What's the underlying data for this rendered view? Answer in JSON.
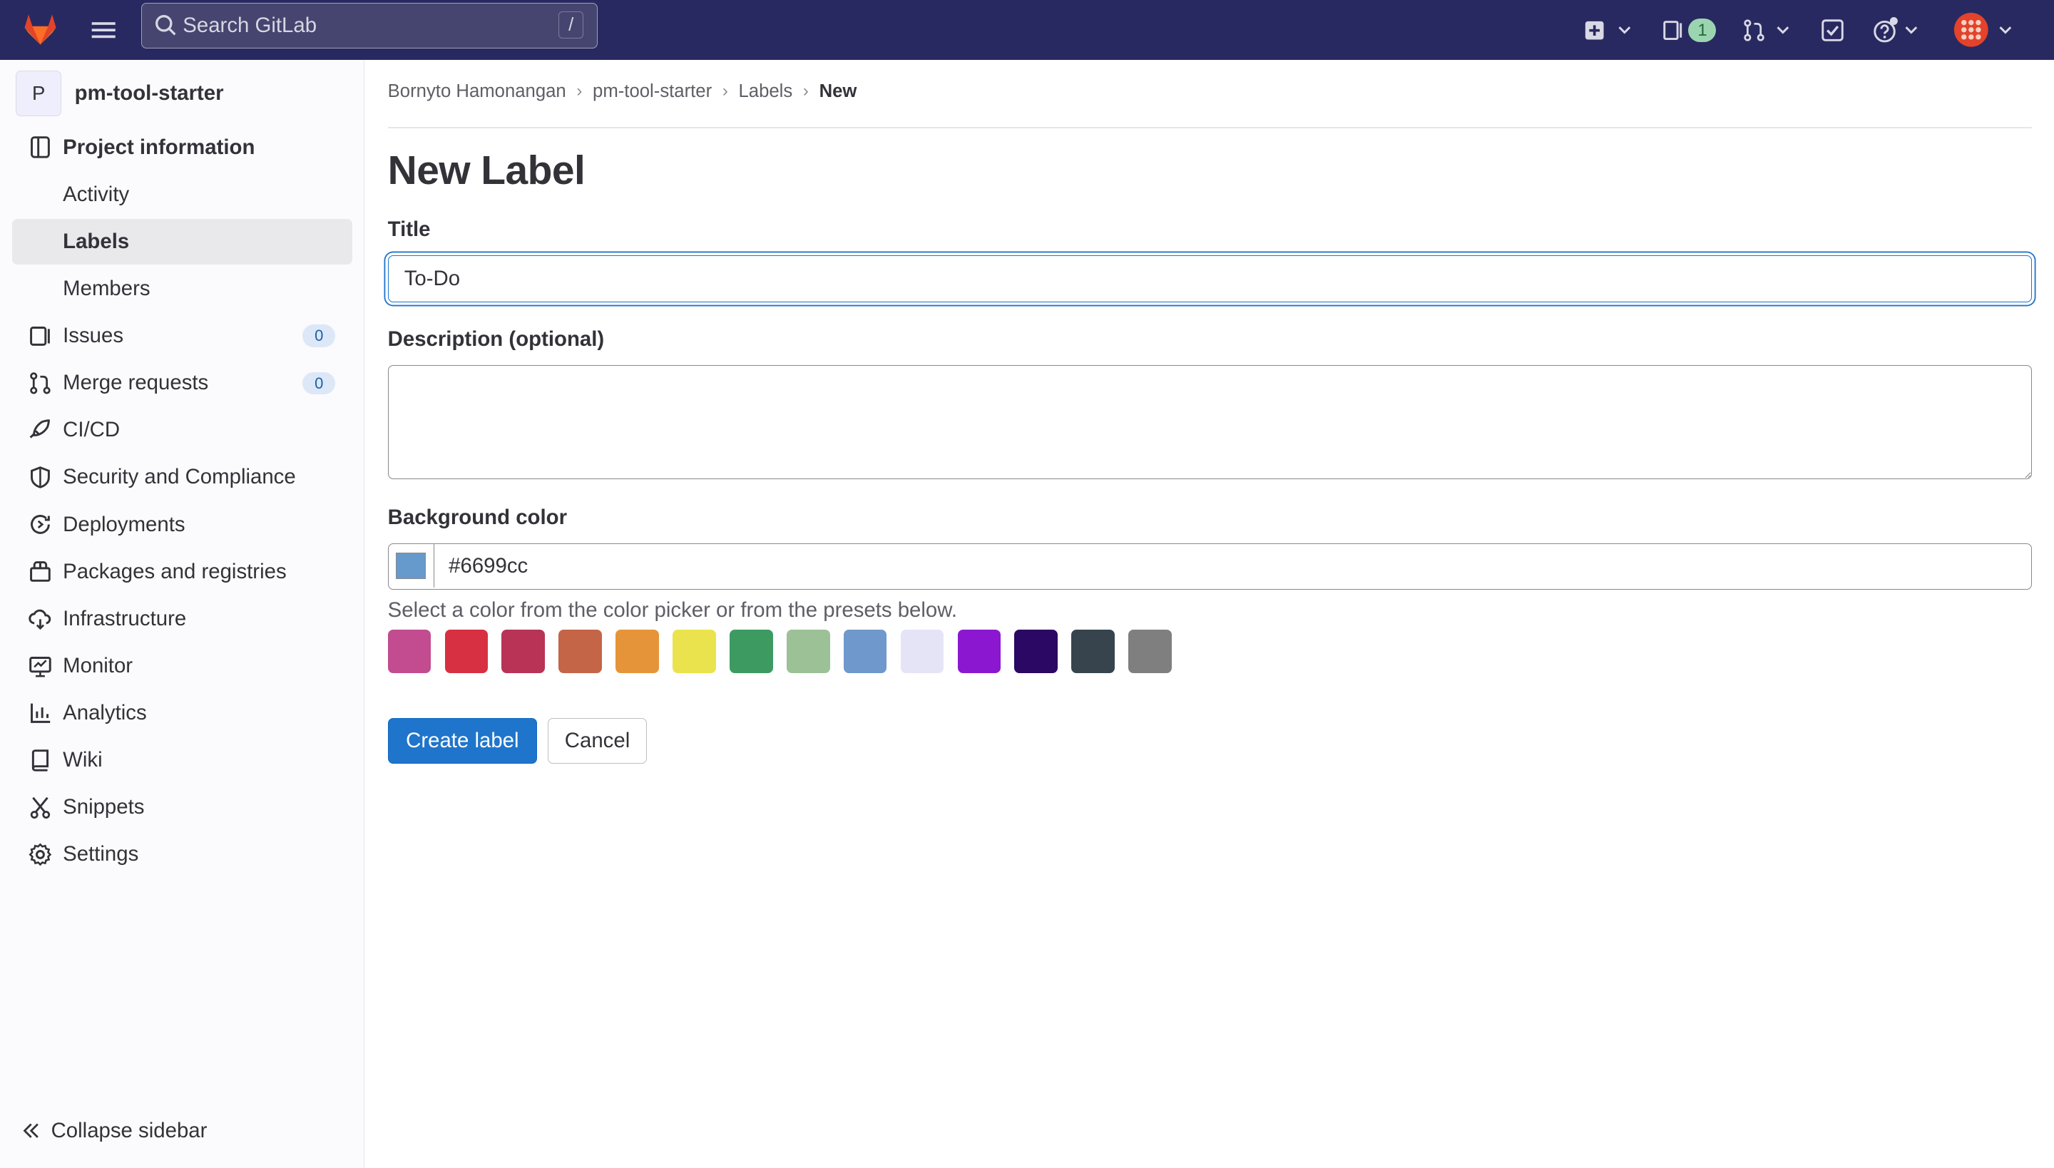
{
  "navbar": {
    "search_placeholder": "Search GitLab",
    "search_shortcut": "/",
    "issues_badge": "1",
    "icons": [
      "gitlab-logo",
      "menu-icon",
      "search-icon",
      "plus-square-icon",
      "issues-icon",
      "merge-request-icon",
      "todo-icon",
      "help-icon",
      "user-avatar"
    ]
  },
  "sidebar": {
    "project_avatar_letter": "P",
    "project_name": "pm-tool-starter",
    "items": [
      {
        "label": "Project information",
        "icon": "info-icon"
      },
      {
        "label": "Activity"
      },
      {
        "label": "Labels"
      },
      {
        "label": "Members"
      },
      {
        "label": "Issues",
        "count": "0",
        "icon": "issues-icon"
      },
      {
        "label": "Merge requests",
        "count": "0",
        "icon": "merge-request-icon"
      },
      {
        "label": "CI/CD",
        "icon": "rocket-icon"
      },
      {
        "label": "Security and Compliance",
        "icon": "shield-icon"
      },
      {
        "label": "Deployments",
        "icon": "deployments-icon"
      },
      {
        "label": "Packages and registries",
        "icon": "package-icon"
      },
      {
        "label": "Infrastructure",
        "icon": "cloud-icon"
      },
      {
        "label": "Monitor",
        "icon": "monitor-icon"
      },
      {
        "label": "Analytics",
        "icon": "chart-icon"
      },
      {
        "label": "Wiki",
        "icon": "book-icon"
      },
      {
        "label": "Snippets",
        "icon": "snippet-icon"
      },
      {
        "label": "Settings",
        "icon": "gear-icon"
      }
    ],
    "collapse_label": "Collapse sidebar"
  },
  "breadcrumbs": [
    "Bornyto Hamonangan",
    "pm-tool-starter",
    "Labels",
    "New"
  ],
  "page_title": "New Label",
  "form": {
    "title_label": "Title",
    "title_value": "To-Do",
    "description_label": "Description (optional)",
    "description_value": "",
    "bg_color_label": "Background color",
    "bg_color_value": "#6699cc",
    "hint": "Select a color from the color picker or from the presets below.",
    "presets": [
      "#c24c8f",
      "#d63042",
      "#b83356",
      "#c46547",
      "#e6943a",
      "#ebe34d",
      "#3d9b62",
      "#9cc196",
      "#6f98cc",
      "#e5e4f7",
      "#8b18d0",
      "#2a0863",
      "#37444d",
      "#7f7f7f"
    ],
    "create_button": "Create label",
    "cancel_button": "Cancel"
  }
}
